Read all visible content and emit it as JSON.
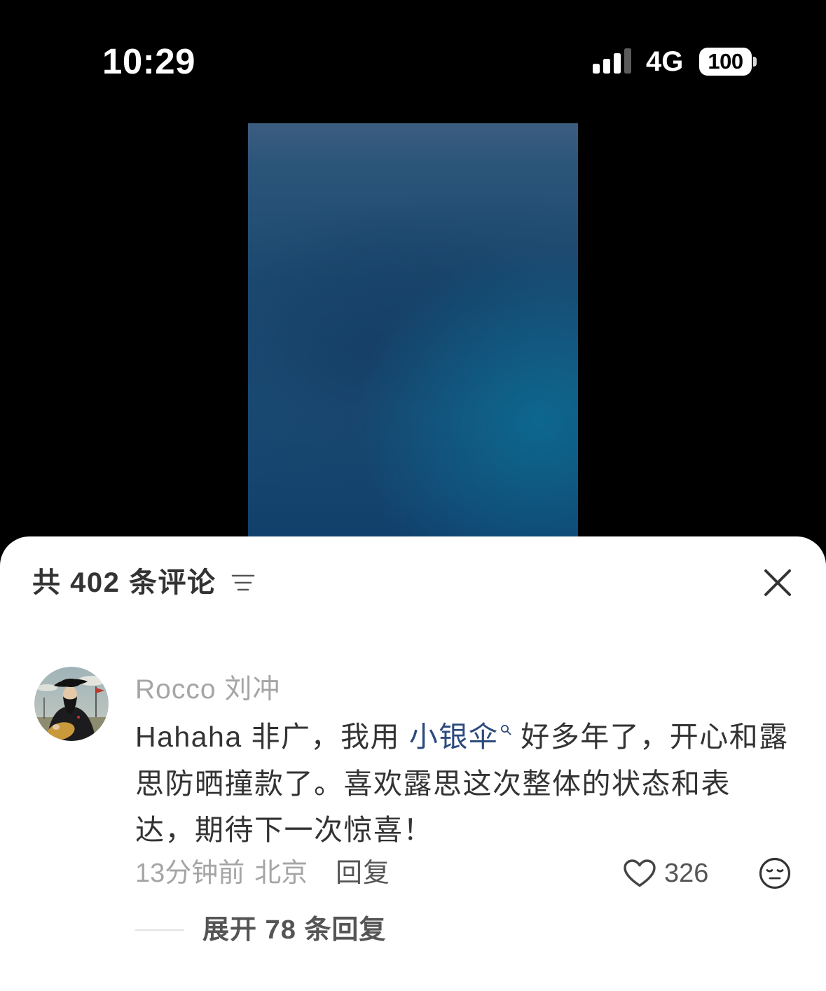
{
  "status_bar": {
    "time": "10:29",
    "network": "4G",
    "battery": "100",
    "icons": {
      "signal": "cellular-signal-icon",
      "battery": "battery-icon"
    }
  },
  "media": {
    "colors": {
      "top": "#3b5d80",
      "middle": "#1d4b72",
      "highlight": "#0870a0",
      "bottom": "#0f3d69"
    }
  },
  "comments_sheet": {
    "title": "共 402 条评论",
    "icons": {
      "sort": "filter-icon",
      "close": "close-icon"
    },
    "comments": [
      {
        "author": "Rocco 刘冲",
        "body": {
          "line1_before_link": "Hahaha 非广，我用 ",
          "link_text": "小银伞",
          "line1_after_link": " 好多年了，开心和露",
          "line2": "思防晒撞款了。喜欢露思这次整体的状态和表",
          "line3": "达，期待下一次惊喜！"
        },
        "time": "13分钟前",
        "location": "北京",
        "reply_label": "回复",
        "like_count": "326",
        "expand_replies_label": "展开 78 条回复",
        "icons": {
          "link": "search-icon",
          "like": "heart-icon",
          "dislike": "meh-face-icon"
        }
      }
    ]
  },
  "colors": {
    "page_background": "#000000",
    "sheet_background": "#ffffff",
    "primary_text": "#333333",
    "secondary_text": "#a5a5a5",
    "action_text": "#555555",
    "link": "#2c4a7c"
  }
}
